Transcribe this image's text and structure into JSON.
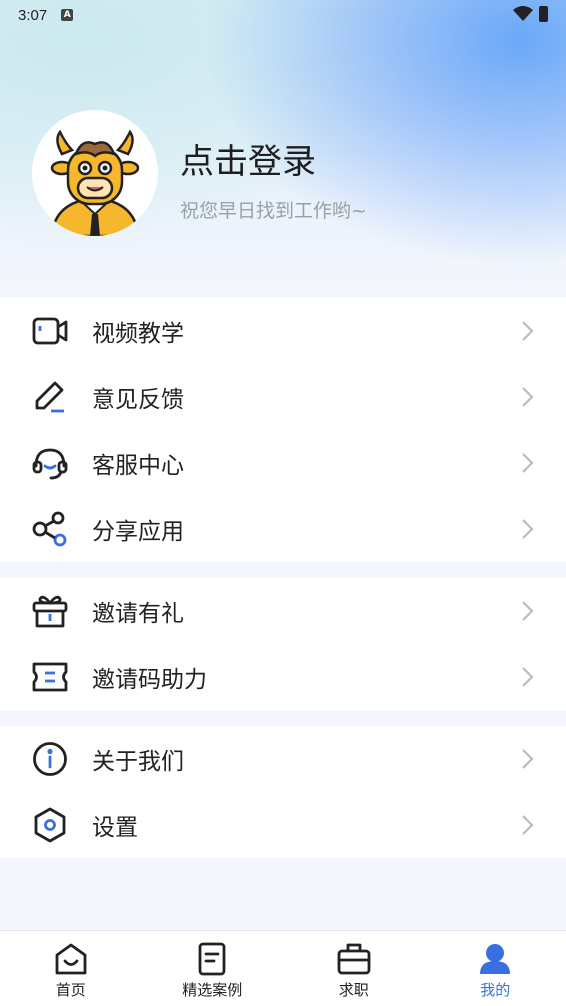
{
  "status_bar": {
    "time": "3:07",
    "notification_badge": "A"
  },
  "profile": {
    "login_title": "点击登录",
    "subtitle": "祝您早日找到工作哟~"
  },
  "menu": {
    "group1": [
      {
        "label": "视频教学",
        "icon": "video-icon"
      },
      {
        "label": "意见反馈",
        "icon": "edit-icon"
      },
      {
        "label": "客服中心",
        "icon": "headset-icon"
      },
      {
        "label": "分享应用",
        "icon": "share-icon"
      }
    ],
    "group2": [
      {
        "label": "邀请有礼",
        "icon": "gift-icon"
      },
      {
        "label": "邀请码助力",
        "icon": "ticket-icon"
      }
    ],
    "group3": [
      {
        "label": "关于我们",
        "icon": "info-icon"
      },
      {
        "label": "设置",
        "icon": "settings-icon"
      }
    ]
  },
  "tabbar": [
    {
      "label": "首页",
      "icon": "home-icon"
    },
    {
      "label": "精选案例",
      "icon": "document-icon"
    },
    {
      "label": "求职",
      "icon": "briefcase-icon"
    },
    {
      "label": "我的",
      "icon": "user-icon",
      "active": true
    }
  ],
  "colors": {
    "accent": "#3a6fe0",
    "icon_stroke": "#222222"
  }
}
